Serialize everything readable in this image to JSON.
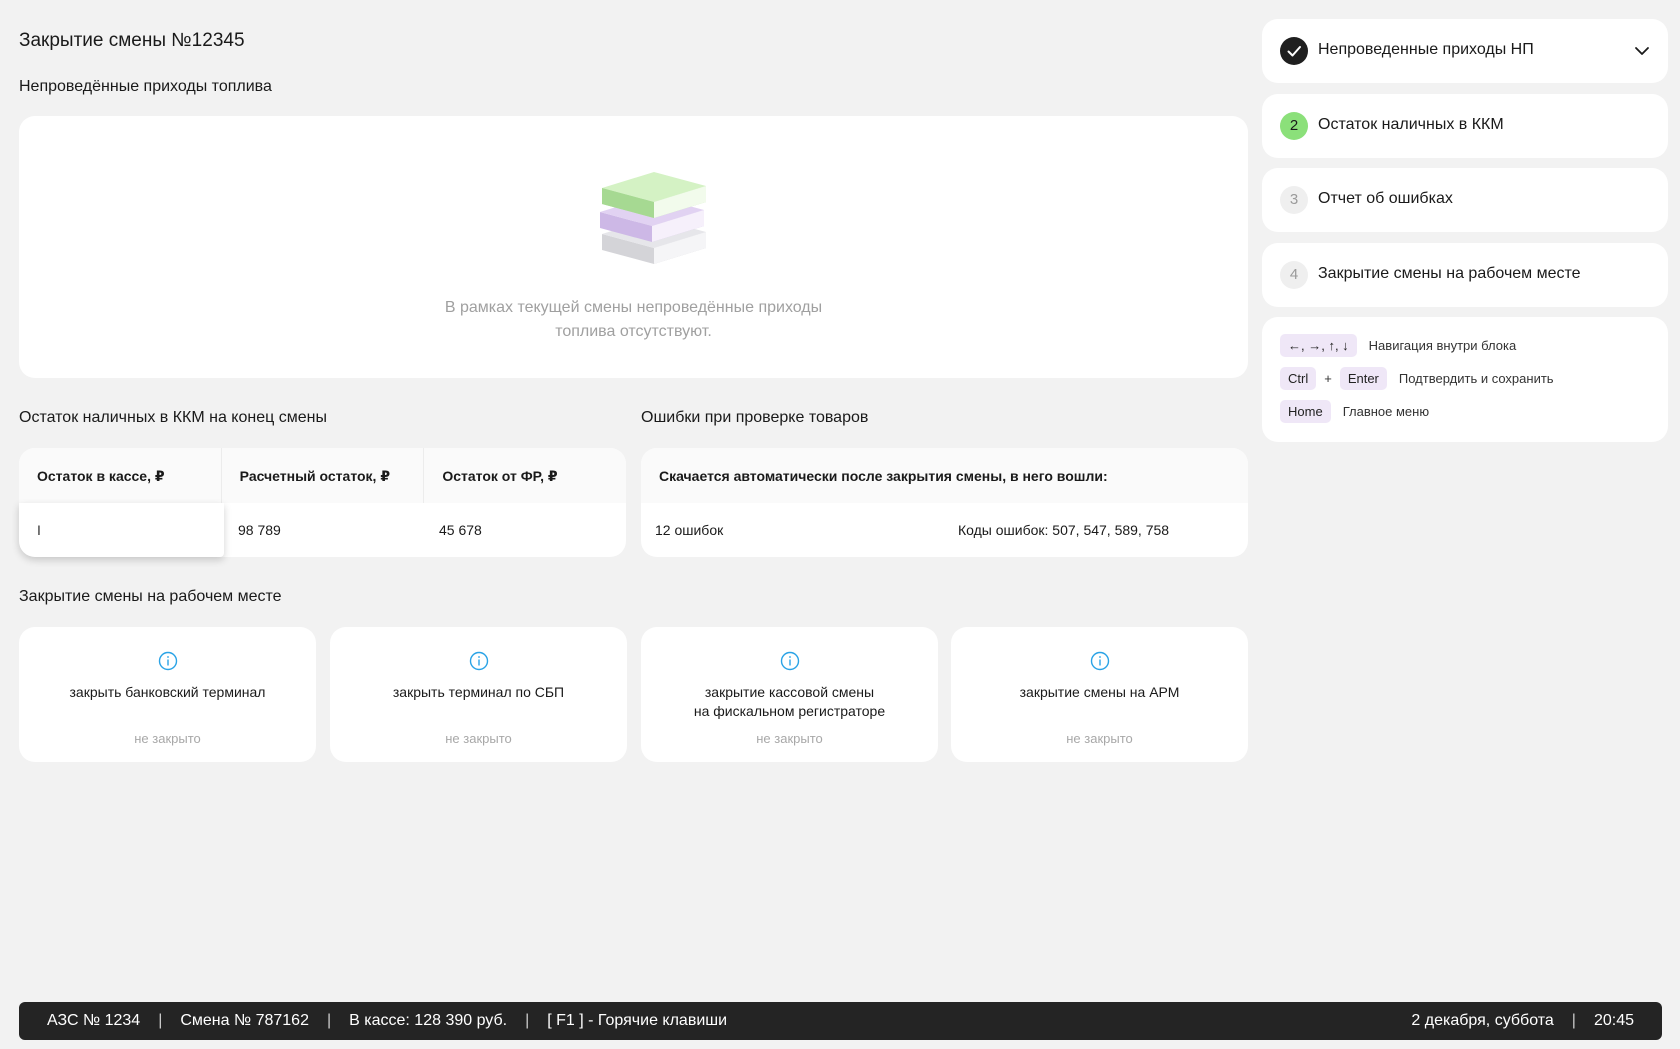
{
  "page": {
    "title": "Закрытие смены №12345",
    "fuel_section_title": "Непроведённые приходы топлива",
    "empty_text_line1": "В рамках текущей смены непроведённые приходы",
    "empty_text_line2": "топлива отсутствуют."
  },
  "cash": {
    "title": "Остаток наличных в ККМ на конец смены",
    "headers": [
      "Остаток в кассе, ₽",
      "Расчетный остаток, ₽",
      "Остаток от ФР, ₽"
    ],
    "input_value": "I",
    "calc_value": "98 789",
    "fr_value": "45 678"
  },
  "errors": {
    "title": "Ошибки при проверке товаров",
    "header": "Скачается автоматически после закрытия смены, в него вошли:",
    "count": "12  ошибок",
    "codes": "Коды ошибок: 507, 547, 589, 758"
  },
  "closing": {
    "title": "Закрытие смены на рабочем месте",
    "tiles": [
      {
        "label1": "закрыть банковский терминал",
        "label2": "",
        "status": "не закрыто"
      },
      {
        "label1": "закрыть терминал по СБП",
        "label2": "",
        "status": "не закрыто"
      },
      {
        "label1": "закрытие кассовой смены",
        "label2": "на фискальном регистраторе",
        "status": "не закрыто"
      },
      {
        "label1": "закрытие смены на АРМ",
        "label2": "",
        "status": "не закрыто"
      }
    ]
  },
  "steps": [
    {
      "badge": "",
      "label": "Непроведенные приходы НП",
      "state": "done",
      "icon": "check-icon"
    },
    {
      "badge": "2",
      "label": "Остаток наличных в ККМ",
      "state": "active"
    },
    {
      "badge": "3",
      "label": "Отчет об ошибках",
      "state": "pending"
    },
    {
      "badge": "4",
      "label": "Закрытие смены на рабочем месте",
      "state": "pending"
    }
  ],
  "hotkeys": {
    "nav_keys": "←, →, ↑, ↓",
    "nav_desc": "Навигация внутри блока",
    "ctrl": "Ctrl",
    "plus": "+",
    "enter": "Enter",
    "confirm_desc": "Подтвердить и сохранить",
    "home": "Home",
    "home_desc": "Главное меню"
  },
  "statusbar": {
    "station": "АЗС № 1234",
    "shift": "Смена № 787162",
    "cash": "В кассе: 128 390 руб.",
    "hotkeys": "[ F1 ] - Горячие клавиши",
    "date": "2 декабря, суббота",
    "time": "20:45",
    "sep": "|"
  },
  "colors": {
    "active_badge": "#8be07a",
    "done_badge": "#1f1f1f",
    "pending_badge": "#efefef",
    "info_icon": "#2aa3e6",
    "key_bg": "#efe7f7",
    "statusbar_bg": "#242424"
  }
}
